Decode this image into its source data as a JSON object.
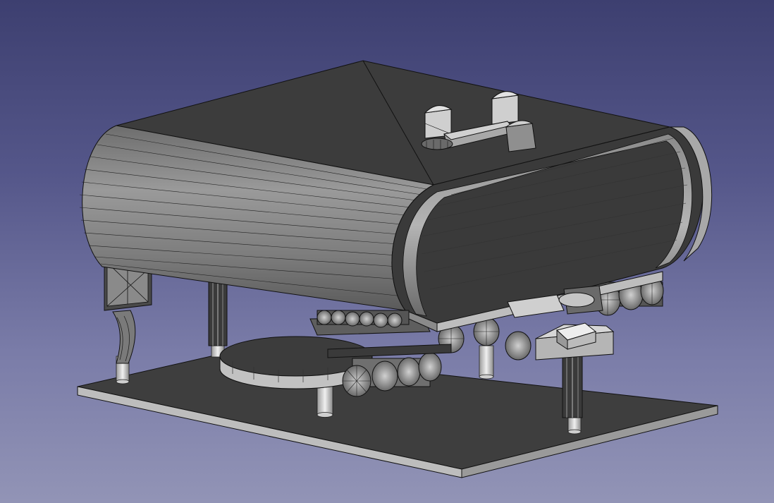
{
  "viewport": {
    "background_top": "#3d3f70",
    "background_bottom": "#9294b6"
  },
  "model": {
    "face_color_dark": "#3c3c3c",
    "face_color_mid": "#7a7a7a",
    "face_color_light": "#c8c8c8",
    "edge_color": "#111111",
    "shading": "flat-lines"
  }
}
